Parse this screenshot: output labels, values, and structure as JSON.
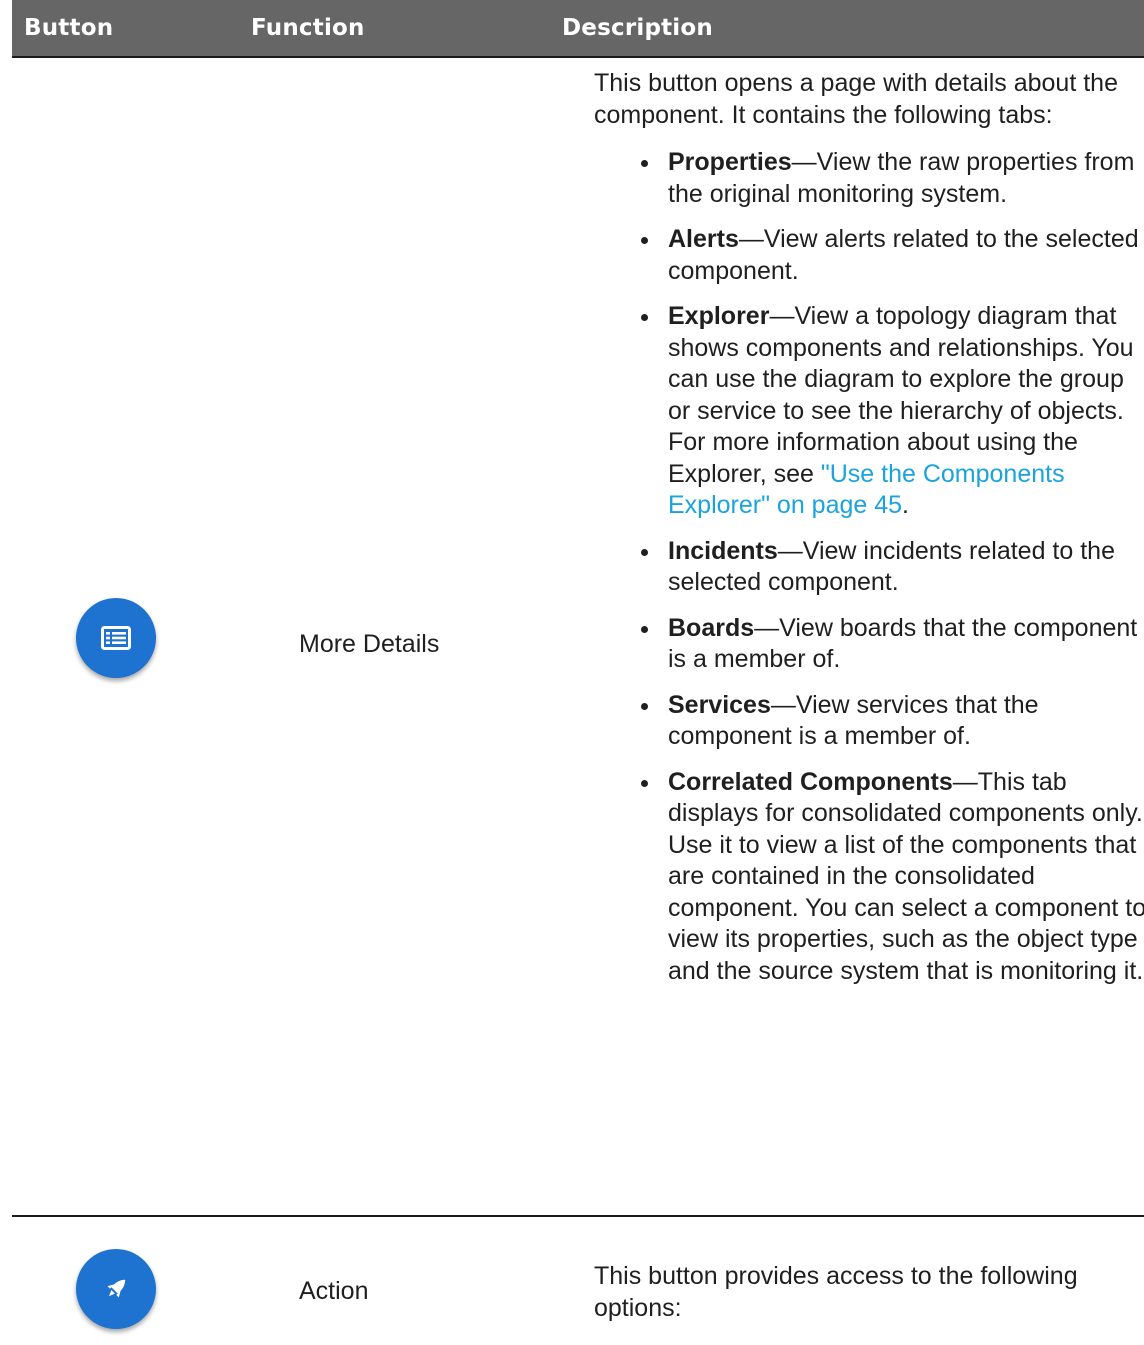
{
  "table": {
    "headers": {
      "button": "Button",
      "function": "Function",
      "description": "Description"
    },
    "rows": [
      {
        "icon": "details-list-icon",
        "function": "More Details",
        "intro": "This button opens a page with details about the component. It contains the following tabs:",
        "items": [
          {
            "term": "Properties",
            "text": "—View the raw properties from the original monitoring system."
          },
          {
            "term": "Alerts",
            "text": "—View alerts related to the selected component."
          },
          {
            "term": "Explorer",
            "text": "—View a topology diagram that shows components and relationships. You can use the diagram to explore the group or service to see the hierarchy of objects. For more information about using the Explorer, see ",
            "link": "\"Use the Components Explorer\" on page 45",
            "after": "."
          },
          {
            "term": "Incidents",
            "text": "—View incidents related to the selected component."
          },
          {
            "term": "Boards",
            "text": "—View boards that the component is a member of."
          },
          {
            "term": "Services",
            "text": "—View services that the component is a member of."
          },
          {
            "term": "Correlated Components",
            "text": "—This tab displays for consolidated components only. Use it to view a list of the components that are contained in the consolidated component. You can select a component to view its properties, such as the object type and the source system that is monitoring it."
          }
        ]
      },
      {
        "icon": "rocket-icon",
        "function": "Action",
        "intro": "This button provides access to the following options:"
      }
    ]
  },
  "colors": {
    "header_bg": "#666666",
    "button_blue": "#1e72d0",
    "link": "#1aa3dc"
  }
}
